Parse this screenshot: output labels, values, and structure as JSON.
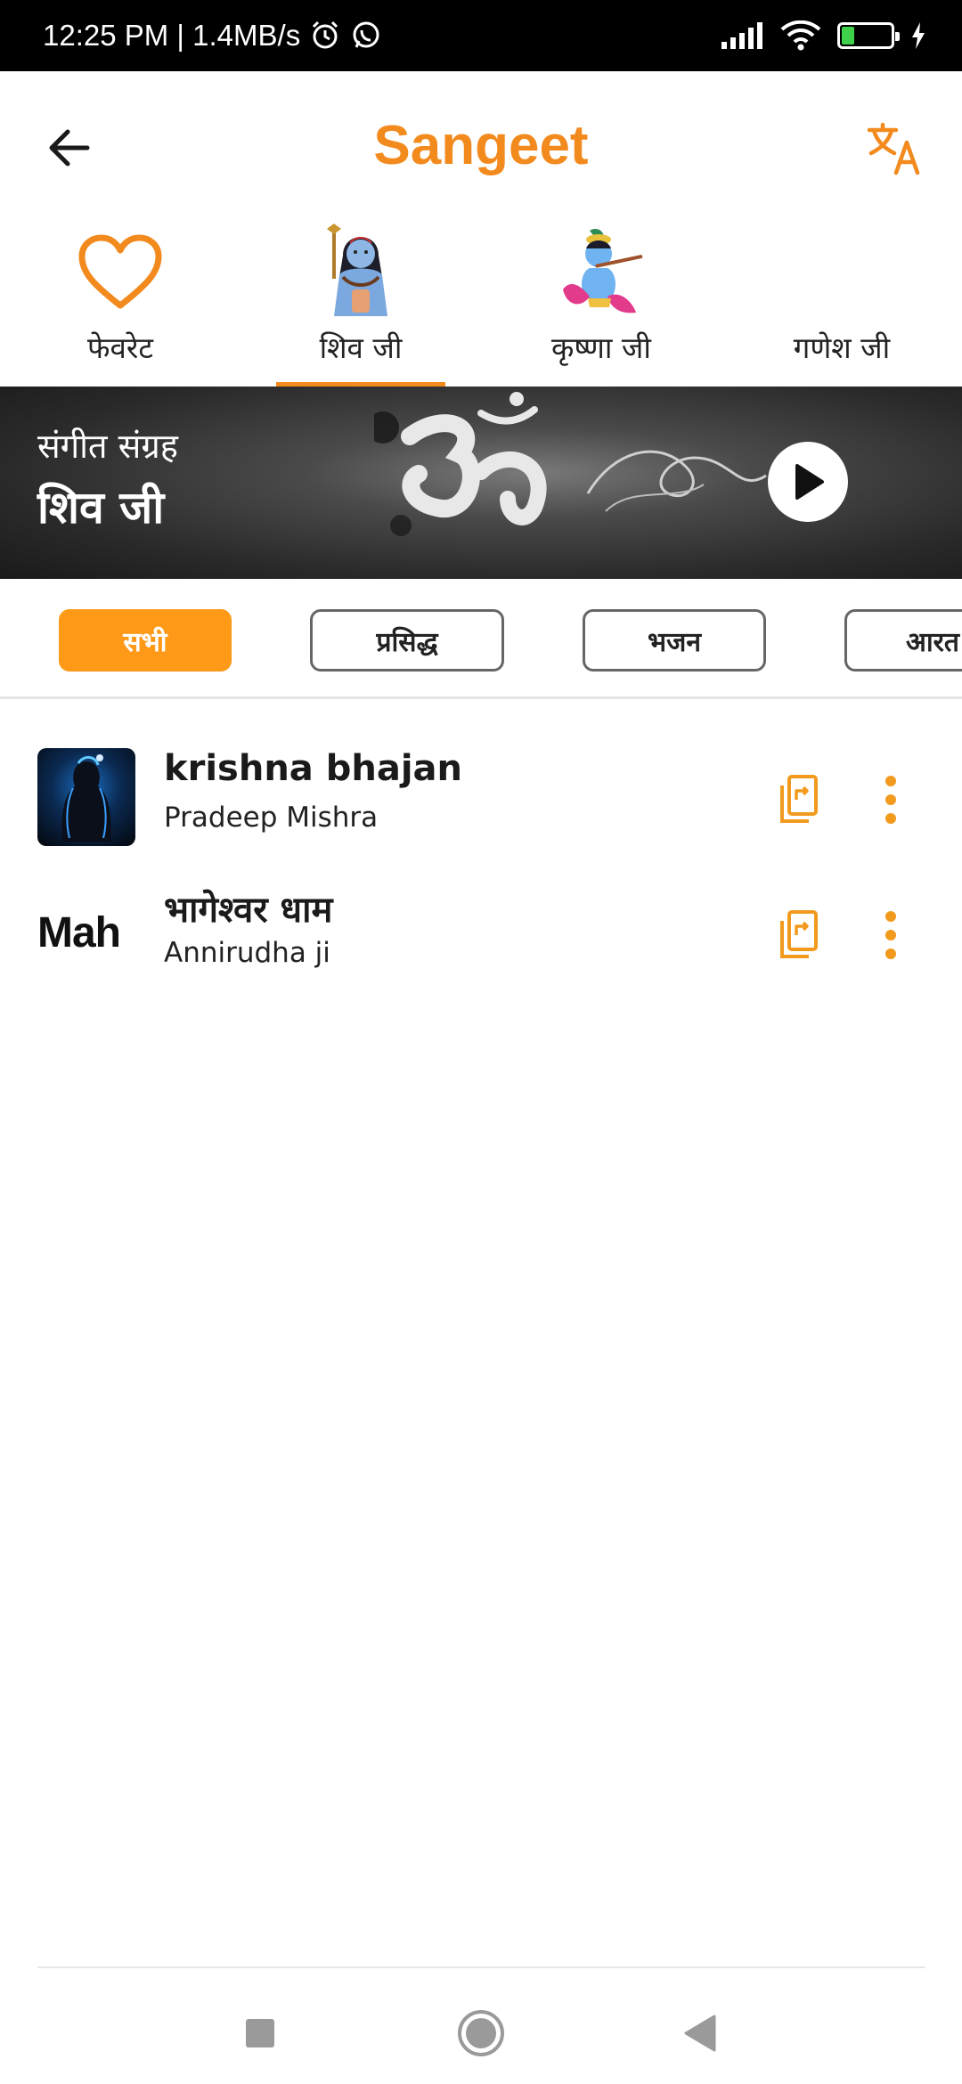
{
  "status_bar": {
    "time_speed": "12:25 PM | 1.4MB/s",
    "alarm_icon": "alarm-icon",
    "whatsapp_icon": "whatsapp-icon",
    "battery_level": "26",
    "battery_color": "#3fd04c"
  },
  "app_bar": {
    "title": "Sangeet",
    "back_icon": "arrow-left-icon",
    "translate_icon": "translate-icon",
    "accent_color": "#f28a1e"
  },
  "category_tabs": [
    {
      "label": "फेवरेट",
      "icon": "heart-icon",
      "active": false
    },
    {
      "label": "शिव जी",
      "icon": "shiva-image",
      "active": true
    },
    {
      "label": "कृष्णा जी",
      "icon": "krishna-image",
      "active": false
    },
    {
      "label": "गणेश जी",
      "icon": "",
      "active": false
    }
  ],
  "banner": {
    "subtitle": "संगीत संग्रह",
    "title": "शिव जी",
    "play_icon": "play-icon"
  },
  "filter_chips": [
    {
      "label": "सभी",
      "active": true
    },
    {
      "label": "प्रसिद्ध",
      "active": false
    },
    {
      "label": "भजन",
      "active": false
    },
    {
      "label": "आरत",
      "active": false
    }
  ],
  "songs": [
    {
      "title": "krishna bhajan",
      "artist": "Pradeep Mishra",
      "art": "shiva-silhouette-image"
    },
    {
      "title": "भागेश्वर धाम",
      "artist": "Annirudha ji",
      "art_text": "Mah"
    }
  ],
  "nav_bar": {
    "recents_icon": "square-icon",
    "home_icon": "circle-icon",
    "back_icon": "triangle-back-icon"
  }
}
